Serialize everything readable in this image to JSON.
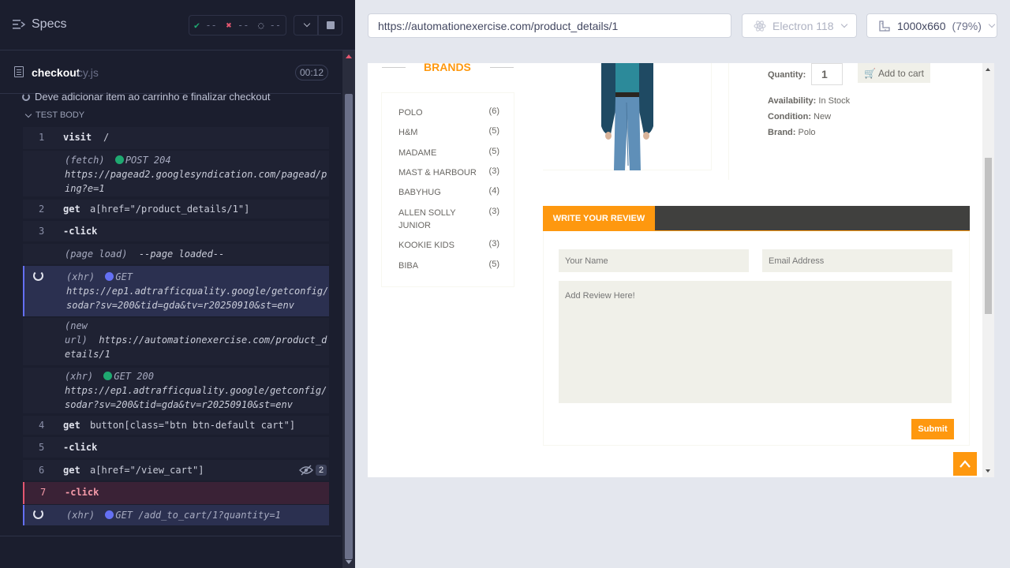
{
  "runner": {
    "specs_label": "Specs",
    "stats": {
      "passed": "--",
      "failed": "--",
      "pending": "--"
    },
    "file": {
      "name": "checkout",
      "ext": ".cy.js",
      "duration": "00:12"
    },
    "test_title": "Deve adicionar item ao carrinho e finalizar checkout",
    "test_body_label": "TEST BODY",
    "commands": [
      {
        "num": "1",
        "name": "visit",
        "message": "/"
      },
      {
        "kind": "fetch",
        "type_label": "(fetch)",
        "text": "POST 204 https://pagead2.googlesyndication.com/pagead/ping?e=1"
      },
      {
        "num": "2",
        "name": "get",
        "message": "a[href=\"/product_details/1\"]"
      },
      {
        "num": "3",
        "name": "-click",
        "message": ""
      },
      {
        "kind": "page load",
        "type_label": "(page load)",
        "text": "--page loaded--"
      },
      {
        "kind": "xhr",
        "type_label": "(xhr)",
        "text": "GET https://ep1.adtrafficquality.google/getconfig/sodar?sv=200&tid=gda&tv=r20250910&st=env"
      },
      {
        "kind": "new url",
        "type_label": "(new url)",
        "text": "https://automationexercise.com/product_details/1"
      },
      {
        "kind": "xhr",
        "type_label": "(xhr)",
        "text": "GET 200 https://ep1.adtrafficquality.google/getconfig/sodar?sv=200&tid=gda&tv=r20250910&st=env"
      },
      {
        "num": "4",
        "name": "get",
        "message": "button[class=\"btn btn-default cart\"]"
      },
      {
        "num": "5",
        "name": "-click",
        "message": ""
      },
      {
        "num": "6",
        "name": "get",
        "message": "a[href=\"/view_cart\"]",
        "badge": "2"
      },
      {
        "num": "7",
        "name": "-click",
        "message": ""
      },
      {
        "kind": "xhr",
        "type_label": "(xhr)",
        "text": "GET /add_to_cart/1?quantity=1"
      }
    ],
    "row_texts": {
      "fetch_status": "POST 204",
      "fetch_url": "https://pagead2.googlesyndication.com/pagead/ping?e=1",
      "xhr1_status": "GET",
      "xhr1_url": "https://ep1.adtrafficquality.google/getconfig/sodar?sv=200&tid=gda&tv=r20250910&st=env",
      "newurl_label_a": "(new",
      "newurl_label_b": "url)",
      "newurl_url": "https://automationexercise.com/product_details/1",
      "xhr2_status": "GET 200",
      "xhr2_url": "https://ep1.adtrafficquality.google/getconfig/sodar?sv=200&tid=gda&tv=r20250910&st=env",
      "xhr3_text": "GET /add_to_cart/1?quantity=1",
      "page_load_text": "--page loaded--"
    }
  },
  "browser": {
    "url": "https://automationexercise.com/product_details/1",
    "browser_name": "Electron 118",
    "viewport": "1000x660",
    "zoom": "(79%)"
  },
  "aut": {
    "brands_title": "BRANDS",
    "brands": [
      {
        "name": "POLO",
        "count": "(6)"
      },
      {
        "name": "H&M",
        "count": "(5)"
      },
      {
        "name": "MADAME",
        "count": "(5)"
      },
      {
        "name": "MAST & HARBOUR",
        "count": "(3)"
      },
      {
        "name": "BABYHUG",
        "count": "(4)"
      },
      {
        "name": "ALLEN SOLLY JUNIOR",
        "count": "(3)"
      },
      {
        "name": "KOOKIE KIDS",
        "count": "(3)"
      },
      {
        "name": "BIBA",
        "count": "(5)"
      }
    ],
    "product": {
      "quantity_label": "Quantity:",
      "quantity_value": "1",
      "add_to_cart": "Add to cart",
      "availability_label": "Availability:",
      "availability": "In Stock",
      "condition_label": "Condition:",
      "condition": "New",
      "brand_label": "Brand:",
      "brand": "Polo"
    },
    "review": {
      "tab_label": "WRITE YOUR REVIEW",
      "name_placeholder": "Your Name",
      "email_placeholder": "Email Address",
      "review_placeholder": "Add Review Here!",
      "submit": "Submit"
    },
    "colors": {
      "accent": "#FE980F",
      "dark_bar": "#40403E",
      "input_bg": "#F0F0E9"
    }
  },
  "colors": {
    "runner_bg": "#1B1E2E",
    "pass": "#1FA971",
    "fail": "#E45770",
    "pending": "#6470F3"
  }
}
